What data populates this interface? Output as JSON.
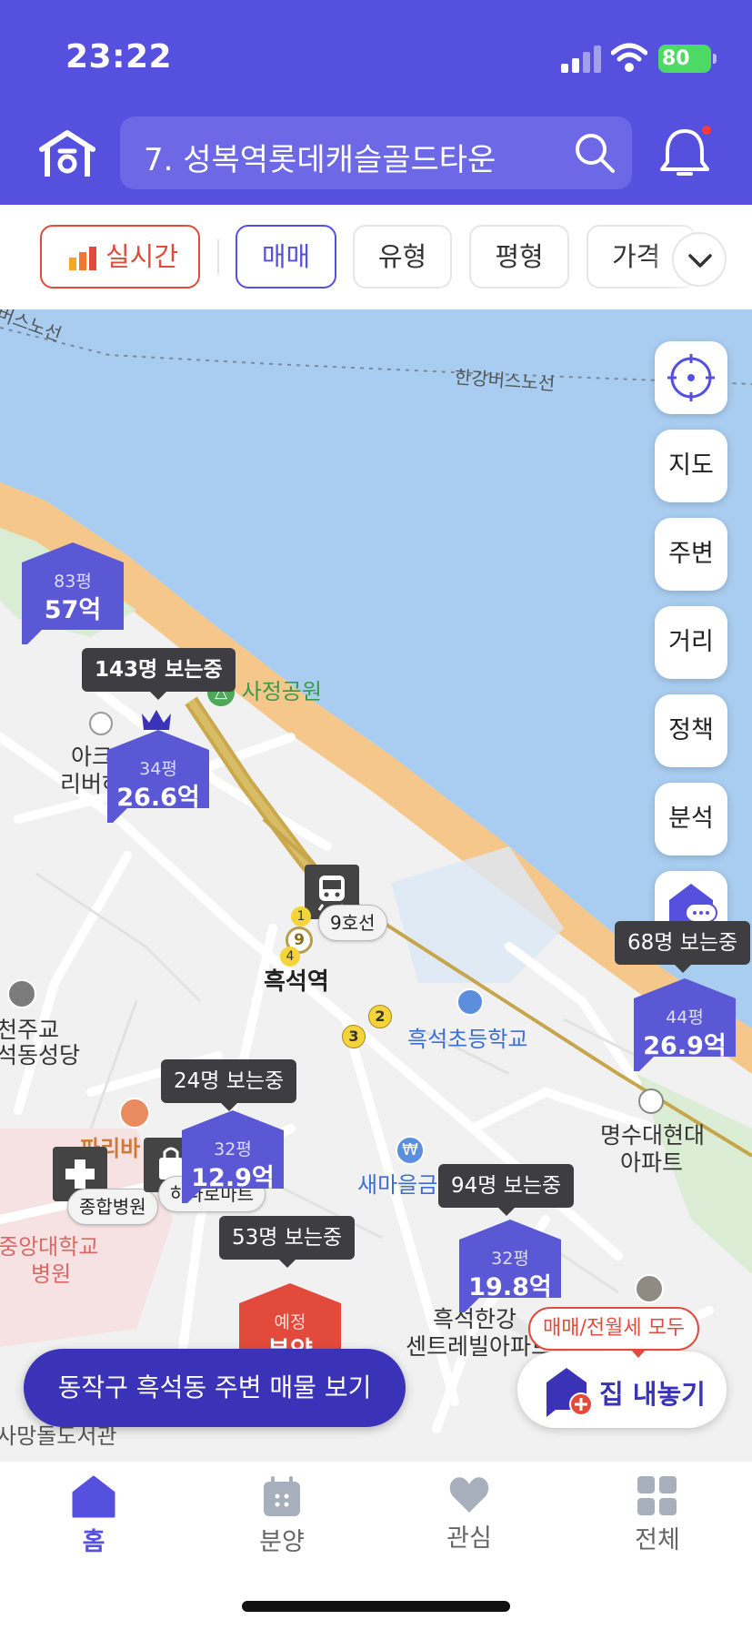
{
  "status_bar": {
    "time": "23:22",
    "battery": "80"
  },
  "header": {
    "search_text": "7. 성복역롯데캐슬골드타운",
    "logo": "home-logo-icon",
    "search_icon": "search-icon",
    "bell_icon": "bell-icon"
  },
  "filters": {
    "realtime": "실시간",
    "items": [
      "매매",
      "유형",
      "평형",
      "가격"
    ],
    "selected": "매매"
  },
  "side_buttons": [
    "지도",
    "주변",
    "거리",
    "정책",
    "분석"
  ],
  "map_labels": {
    "bus_route_left": "버스노선",
    "bus_route": "한강버스노선",
    "park": "사정공원",
    "apt1_line1": "아크로",
    "apt1_line2": "리버하임",
    "station": "흑석역",
    "line9": "9호선",
    "school": "흑석초등학교",
    "church_line1": "천주교",
    "church_line2": "석동성당",
    "market": "새마을금",
    "apt2_line1": "명수대현대",
    "apt2_line2": "아파트",
    "bakery": "파리바",
    "hospital_line1": "중앙대학교",
    "hospital_line2": "병원",
    "apt3_line1": "흑석한강",
    "apt3_line2": "센트레빌아파트",
    "library": "사망돌도서관",
    "hospital_tag": "종합병원",
    "mart_tag": "하나로마트",
    "line_num_9": "9",
    "line_num_2": "2",
    "line_num_3": "3",
    "line_num_4": "4",
    "line_num_1": "1"
  },
  "markers": [
    {
      "size": "83평",
      "price": "57억"
    },
    {
      "size": "34평",
      "price": "26.6억",
      "viewers": "143명 보는중"
    },
    {
      "size": "44평",
      "price": "26.9억",
      "viewers": "68명 보는중"
    },
    {
      "size": "32평",
      "price": "12.9억",
      "viewers": "24명 보는중"
    },
    {
      "size": "32평",
      "price": "19.8억",
      "viewers": "94명 보는중"
    },
    {
      "size": "예정",
      "price": "분양",
      "viewers": "53명 보는중"
    }
  ],
  "bottom_actions": {
    "nearby": "동작구 흑석동 주변 매물 보기",
    "list_bubble": "매매/전월세 모두",
    "list_button": "집 내놓기"
  },
  "tabs": [
    {
      "label": "홈",
      "icon": "home-icon",
      "active": true
    },
    {
      "label": "분양",
      "icon": "calendar-icon",
      "active": false
    },
    {
      "label": "관심",
      "icon": "heart-icon",
      "active": false
    },
    {
      "label": "전체",
      "icon": "grid-icon",
      "active": false
    }
  ],
  "colors": {
    "brand": "#5650de",
    "accent_red": "#e24b3b",
    "water": "#a9cdf0",
    "riverbank": "#f5c78a"
  }
}
